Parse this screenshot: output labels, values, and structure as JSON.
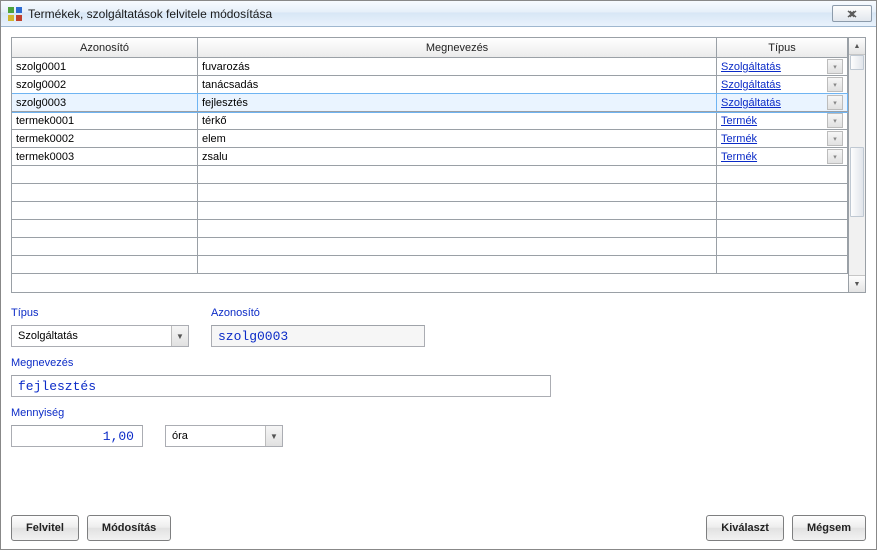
{
  "window": {
    "title": "Termékek, szolgáltatások felvitele módosítása"
  },
  "grid": {
    "headers": {
      "id": "Azonosító",
      "name": "Megnevezés",
      "type": "Típus"
    },
    "selected_index": 2,
    "rows": [
      {
        "id": "szolg0001",
        "name": "fuvarozás",
        "type": "Szolgáltatás"
      },
      {
        "id": "szolg0002",
        "name": "tanácsadás",
        "type": "Szolgáltatás"
      },
      {
        "id": "szolg0003",
        "name": "fejlesztés",
        "type": "Szolgáltatás"
      },
      {
        "id": "termek0001",
        "name": "térkő",
        "type": "Termék"
      },
      {
        "id": "termek0002",
        "name": "elem",
        "type": "Termék"
      },
      {
        "id": "termek0003",
        "name": "zsalu",
        "type": "Termék"
      }
    ],
    "blank_rows": 6
  },
  "form": {
    "labels": {
      "type": "Típus",
      "id": "Azonosító",
      "name": "Megnevezés",
      "qty": "Mennyiség"
    },
    "type_value": "Szolgáltatás",
    "id_value": "szolg0003",
    "name_value": "fejlesztés",
    "qty_value": "1,00",
    "unit_value": "óra"
  },
  "buttons": {
    "add": "Felvitel",
    "edit": "Módosítás",
    "select": "Kiválaszt",
    "cancel": "Mégsem"
  }
}
